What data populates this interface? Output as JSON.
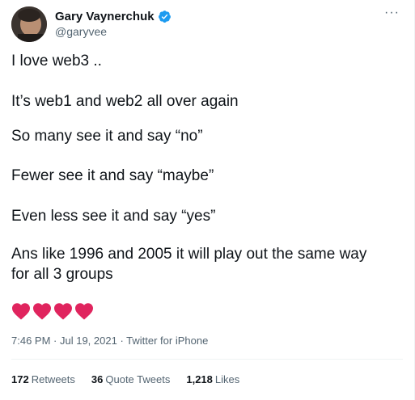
{
  "author": {
    "name": "Gary Vaynerchuk",
    "handle": "@garyvee",
    "verified": true
  },
  "tweet": {
    "lines": [
      "I love web3 ..",
      "It’s web1 and web2 all over again",
      "So many see it and say “no”",
      "Fewer see it and say “maybe”",
      "Even less see it and say “yes”",
      "Ans like 1996 and 2005 it will play out the same way",
      "for all 3 groups"
    ],
    "emoji": [
      "red-heart",
      "red-heart",
      "red-heart",
      "red-heart"
    ]
  },
  "meta": {
    "time": "7:46 PM",
    "separator": " · ",
    "date": "Jul 19, 2021",
    "source": "Twitter for iPhone"
  },
  "stats": {
    "retweets_count": "172",
    "retweets_label": "Retweets",
    "quotes_count": "36",
    "quotes_label": "Quote Tweets",
    "likes_count": "1,218",
    "likes_label": "Likes"
  },
  "more_label": "···",
  "colors": {
    "text": "#0f1419",
    "secondary": "#536471",
    "verified": "#1d9bf0",
    "heart": "#e0245e",
    "divider": "#eff3f4"
  }
}
